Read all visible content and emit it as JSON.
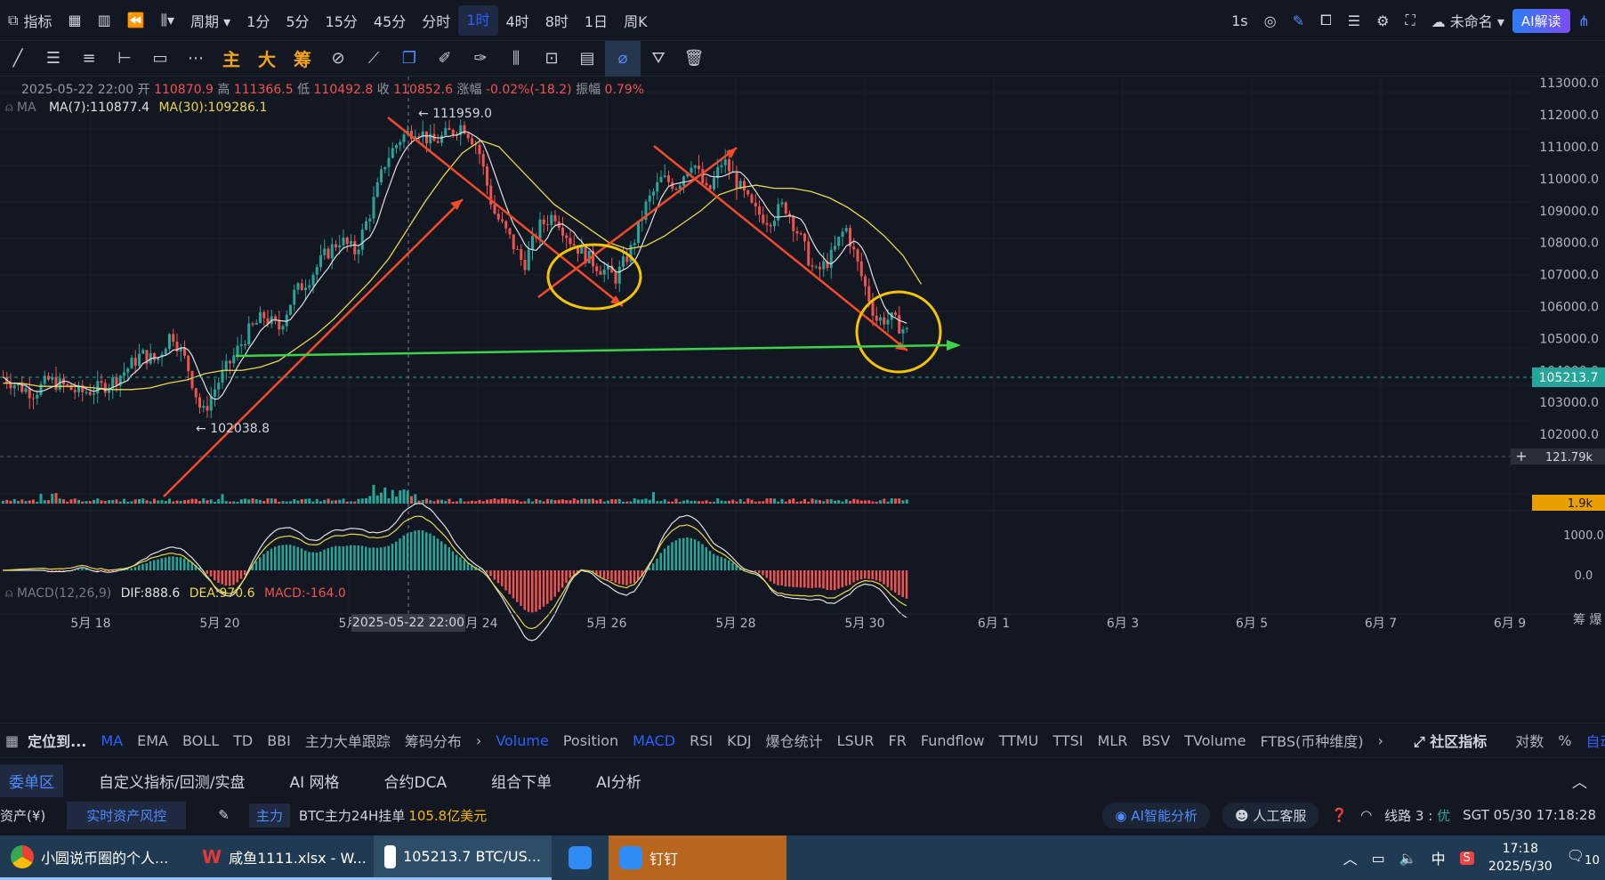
{
  "toolbar": {
    "indicator_label": "指标",
    "period_label": "周期",
    "intervals": [
      "1分",
      "5分",
      "15分",
      "45分",
      "分时",
      "1时",
      "4时",
      "8时",
      "1日",
      "周K"
    ],
    "active_interval": "1时",
    "right_interval": "1s",
    "layout_name": "未命名",
    "ai_button": "AI解读"
  },
  "drawtools": {
    "zhu": "主",
    "da": "大",
    "chou": "筹"
  },
  "ohlc": {
    "date": "2025-05-22 22:00",
    "open_label": "开",
    "open": "110870.9",
    "high_label": "高",
    "high": "111366.5",
    "low_label": "低",
    "low": "110492.8",
    "close_label": "收",
    "close": "110852.6",
    "change_label": "涨幅",
    "change": "-0.02%(-18.2)",
    "amp_label": "振幅",
    "amp": "0.79%"
  },
  "ma": {
    "label": "MA",
    "ma7": "MA(7):110877.4",
    "ma30": "MA(30):109286.1"
  },
  "macd": {
    "label": "MACD(12,26,9)",
    "dif": "DIF:888.6",
    "dea": "DEA:970.6",
    "macd": "MACD:-164.0"
  },
  "chart_data": {
    "type": "candlestick",
    "price_axis": [
      "113000.0",
      "112000.0",
      "111000.0",
      "110000.0",
      "109000.0",
      "108000.0",
      "107000.0",
      "106000.0",
      "105000.0",
      "104000.0",
      "103000.0",
      "102000.0"
    ],
    "current_price": "105213.7",
    "high_mark": "111959.0",
    "low_mark": "102038.8",
    "volume_axis": "121.79k",
    "volume_current": "1.9k",
    "macd_axis": [
      "1000.0",
      "0.0"
    ],
    "x_labels": [
      "5月 18",
      "5月 20",
      "5月",
      "5月 24",
      "5月 26",
      "5月 28",
      "5月 30",
      "6月 1",
      "6月 3",
      "6月 5",
      "6月 7",
      "6月 9"
    ],
    "crosshair_time": "2025-05-22 22:00",
    "ylim": [
      101500,
      113200
    ],
    "close_path": [
      103800,
      103500,
      103300,
      103700,
      103500,
      103300,
      103400,
      103600,
      104000,
      104500,
      104300,
      105200,
      104200,
      102600,
      103600,
      104400,
      105200,
      105700,
      105300,
      106400,
      106900,
      107600,
      108100,
      107700,
      109000,
      110600,
      111300,
      111600,
      111100,
      111400,
      111700,
      111000,
      109000,
      108200,
      107300,
      108500,
      108900,
      108100,
      107600,
      107200,
      106900,
      107800,
      109200,
      110000,
      109800,
      110600,
      109500,
      110600,
      109800,
      109000,
      108700,
      109200,
      108200,
      107000,
      107500,
      108500,
      107000,
      105600,
      105600,
      105200
    ],
    "ma30_path": [
      103600,
      103600,
      103500,
      103500,
      103500,
      103450,
      103400,
      103400,
      103450,
      103600,
      103700,
      103900,
      104000,
      104000,
      104100,
      104300,
      104700,
      105100,
      105600,
      106200,
      106800,
      107500,
      108400,
      109300,
      110100,
      110800,
      111200,
      111000,
      110400,
      109800,
      109200,
      108800,
      108400,
      108000,
      107800,
      107900,
      108200,
      108600,
      109000,
      109500,
      109700,
      109800,
      109700,
      109700,
      109600,
      109400,
      109100,
      108700,
      108200,
      107600,
      106700
    ]
  },
  "indicators_bar": {
    "locate": "定位到...",
    "main": [
      "MA",
      "EMA",
      "BOLL",
      "TD",
      "BBI",
      "主力大单跟踪",
      "筹码分布"
    ],
    "sub": [
      "Volume",
      "Position",
      "MACD",
      "RSI",
      "KDJ",
      "爆仓统计",
      "LSUR",
      "FR",
      "Fundflow",
      "TTMU",
      "TTSI",
      "MLR",
      "BSV",
      "TVolume",
      "FTBS(币种维度)"
    ],
    "community": "社区指标",
    "log": "对数",
    "percent": "%",
    "auto": "自动"
  },
  "bottom_tabs": [
    "委单区",
    "自定义指标/回测/实盘",
    "AI 网格",
    "合约DCA",
    "组合下单",
    "AI分析"
  ],
  "info": {
    "assets": "资产(¥)",
    "risk": "实时资产风控",
    "main_tag": "主力",
    "btc_text": "BTC主力24H挂单",
    "btc_value": "105.8亿美元",
    "ai_analysis": "AI智能分析",
    "service": "人工客服",
    "line": "线路 3 :",
    "line_status": "优",
    "time": "SGT  05/30 17:18:28"
  },
  "taskbar": {
    "items": [
      "小圆说币圈的个人...",
      "咸鱼1111.xlsx - W...",
      "105213.7 BTC/US...",
      "",
      "钉钉"
    ],
    "ime": "中",
    "clock_time": "17:18",
    "clock_date": "2025/5/30",
    "notif": "10"
  }
}
